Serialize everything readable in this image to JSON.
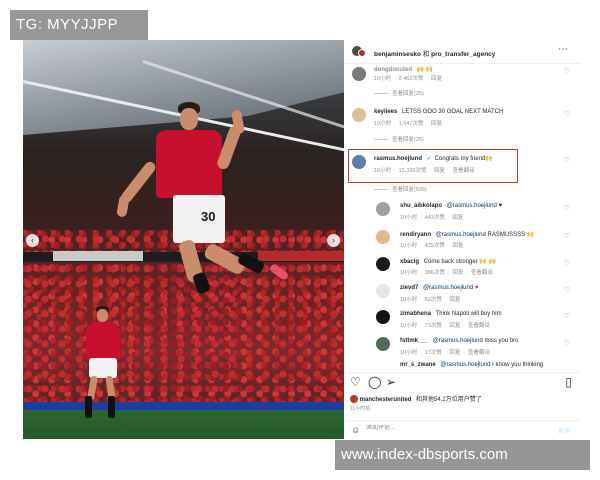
{
  "banner": {
    "tg_label": "TG: MYYJJPP"
  },
  "watermark": {
    "url": "www.index-dbsports.com"
  },
  "photo": {
    "player_number": "30",
    "nav_prev": "‹",
    "nav_next": "›"
  },
  "post": {
    "header": {
      "author": "benjaminsesko",
      "conjunction": "和",
      "coauthor": "pro_transfer_agency",
      "more": "⋯"
    },
    "comments": [
      {
        "user": "dongducuted",
        "text": "🙌 🙌",
        "meta": [
          "10小时",
          "2,462次赞",
          "回复"
        ],
        "replies": "查看回复(25)"
      },
      {
        "user": "keyliees",
        "text": "LETSS GOO 30 GOAL NEXT MATCH",
        "meta": [
          "10小时",
          "1,547次赞",
          "回复"
        ],
        "replies": "查看回复(25)"
      },
      {
        "user": "rasmus.hoejlund",
        "verified": "✔",
        "text": "Congrats my friend🙌",
        "meta": [
          "10小时",
          "15,320次赞",
          "回复",
          "查看翻译"
        ],
        "replies": "查看回复(536)"
      }
    ],
    "replies": [
      {
        "user": "shu_aibkolapo",
        "mention": "@rasmus.hoejlund",
        "text": "♥",
        "meta": [
          "10小时",
          "443次赞",
          "回复"
        ]
      },
      {
        "user": "rendiryann",
        "mention": "@rasmus.hoejlund",
        "text": "RASMUSSSS 🙌",
        "meta": [
          "10小时",
          "425次赞",
          "回复"
        ]
      },
      {
        "user": "xbacig",
        "mention": "",
        "text": "Come back stronger 🙌 🙌",
        "meta": [
          "10小时",
          "386次赞",
          "回复",
          "查看翻译"
        ]
      },
      {
        "user": "zievd7",
        "mention": "@rasmus.hoejlund",
        "text": "♥",
        "meta": [
          "10小时",
          "82次赞",
          "回复"
        ]
      },
      {
        "user": "zimabhena",
        "mention": "",
        "text": "Think Napoli will buy him",
        "meta": [
          "10小时",
          "73次赞",
          "回复",
          "查看翻译"
        ]
      },
      {
        "user": "fsttmk___",
        "mention": "@rasmus.hoejlund",
        "text": "miss you bro",
        "meta": [
          "10小时",
          "17次赞",
          "回复",
          "查看翻译"
        ]
      },
      {
        "user": "mr_s_zwane",
        "mention": "@rasmus.hoejlund",
        "text": "I know you thinking",
        "meta": []
      }
    ],
    "likes": {
      "user": "manchesterunited",
      "text": "和其他54.2万位用户赞了"
    },
    "time_ago": "11小时前",
    "add_comment": {
      "placeholder": "添加评论...",
      "post_label": "发布"
    }
  }
}
